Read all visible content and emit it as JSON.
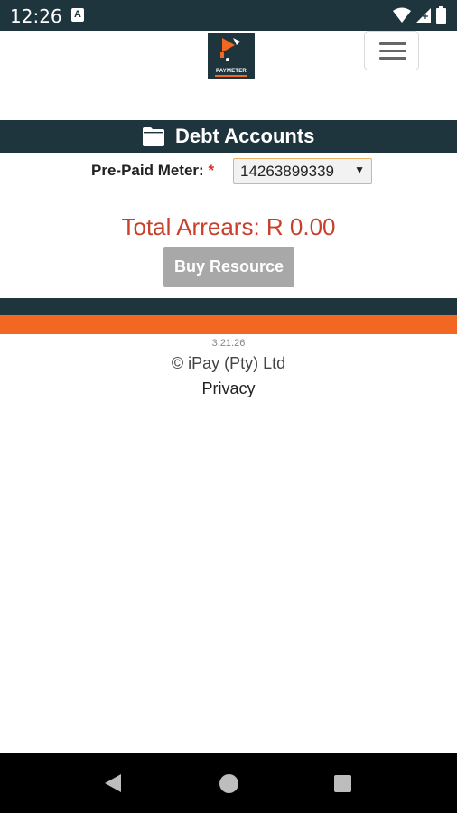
{
  "status_bar": {
    "time": "12:26",
    "notification_icon": "a-notification-icon",
    "icons": [
      "wifi-icon",
      "signal-icon",
      "battery-icon"
    ]
  },
  "header": {
    "logo_text": "PAYMETER",
    "menu_icon": "hamburger-menu-icon"
  },
  "page": {
    "title": "Debt Accounts",
    "title_icon": "folder-icon"
  },
  "form": {
    "meter_label": "Pre-Paid Meter:",
    "required_mark": "*",
    "meter_selected": "14263899339",
    "dropdown_arrow": "▼"
  },
  "summary": {
    "arrears": "Total Arrears: R 0.00"
  },
  "actions": {
    "buy_label": "Buy Resource"
  },
  "footer": {
    "version": "3.21.26",
    "copyright": "© iPay (Pty) Ltd",
    "privacy": "Privacy"
  },
  "colors": {
    "brand_dark": "#1f353d",
    "brand_orange": "#f26722",
    "arrears_red": "#c9402c",
    "button_disabled": "#a8a8a8"
  }
}
